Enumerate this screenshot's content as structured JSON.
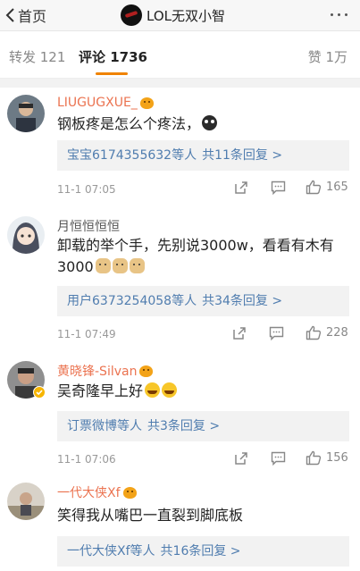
{
  "nav": {
    "back_label": "首页",
    "title": "LOL无双小智"
  },
  "tabs": {
    "repost": "转发 121",
    "comment": "评论 1736",
    "like": "赞 1万"
  },
  "comments": [
    {
      "user": "LIUGUGXUE_",
      "text": "钢板疼是怎么个疼法，",
      "reply_users": "宝宝6174355632等人",
      "reply_count": "共11条回复 >",
      "time": "11-1 07:05",
      "likes": "165"
    },
    {
      "user": "月恒恒恒恒",
      "text": "卸载的举个手，先别说3000w，看看有木有3000",
      "reply_users": "用户6373254058等人",
      "reply_count": "共34条回复 >",
      "time": "11-1 07:49",
      "likes": "228"
    },
    {
      "user": "黄晓锋-Silvan",
      "text": "吴奇隆早上好",
      "reply_users": "订票微博等人",
      "reply_count": "共3条回复 >",
      "time": "11-1 07:06",
      "likes": "156"
    },
    {
      "user": "一代大侠Xf",
      "text": "笑得我从嘴巴一直裂到脚底板",
      "reply_users": "一代大侠Xf等人",
      "reply_count": "共16条回复 >"
    }
  ],
  "icons": {
    "back": "chevron-left-icon",
    "more": "more-dots-icon",
    "share": "share-icon",
    "reply": "comment-icon",
    "like": "thumbs-up-icon"
  },
  "colors": {
    "accent": "#f08300",
    "username": "#eb7350",
    "link": "#507daf"
  }
}
